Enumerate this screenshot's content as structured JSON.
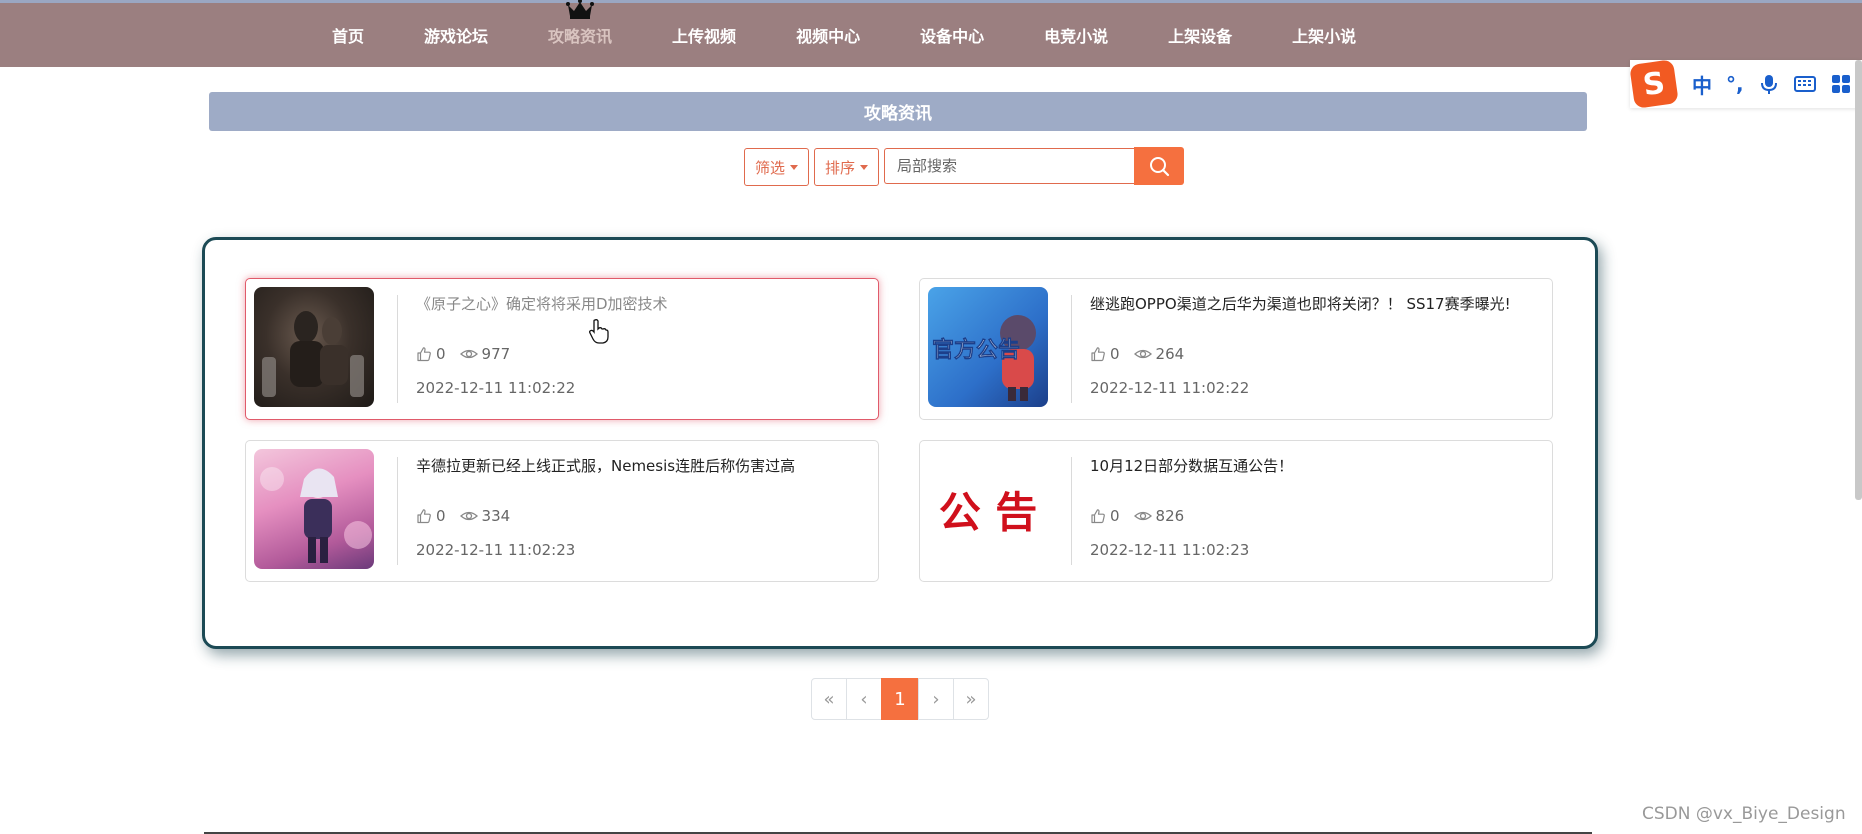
{
  "nav": {
    "items": [
      {
        "label": "首页"
      },
      {
        "label": "游戏论坛"
      },
      {
        "label": "攻略资讯"
      },
      {
        "label": "上传视频"
      },
      {
        "label": "视频中心"
      },
      {
        "label": "设备中心"
      },
      {
        "label": "电竞小说"
      },
      {
        "label": "上架设备"
      },
      {
        "label": "上架小说"
      }
    ],
    "active_index": 2,
    "active_icon": "crown-icon"
  },
  "ime": {
    "logo": "S",
    "mode": "中",
    "punct": "°,",
    "icons": [
      "microphone-icon",
      "keyboard-icon",
      "grid-icon"
    ]
  },
  "page": {
    "title": "攻略资讯"
  },
  "toolbar": {
    "filter_label": "筛选",
    "sort_label": "排序",
    "search_placeholder": "局部搜索",
    "search_icon": "search-icon"
  },
  "articles": [
    {
      "title": "《原子之心》确定将将采用D加密技术",
      "likes": "0",
      "views": "977",
      "date": "2022-12-11 11:02:22"
    },
    {
      "title": "继逃跑OPPO渠道之后华为渠道也即将关闭？！ SS17赛季曝光!",
      "likes": "0",
      "views": "264",
      "date": "2022-12-11 11:02:22",
      "thumb_text": "官方公告"
    },
    {
      "title": "辛德拉更新已经上线正式服，Nemesis连胜后称伤害过高",
      "likes": "0",
      "views": "334",
      "date": "2022-12-11 11:02:23"
    },
    {
      "title": "10月12日部分数据互通公告！",
      "likes": "0",
      "views": "826",
      "date": "2022-12-11 11:02:23",
      "thumb_text": "公 告"
    }
  ],
  "pagination": {
    "first": "«",
    "prev": "‹",
    "current": "1",
    "next": "›",
    "last": "»"
  },
  "colors": {
    "navbar": "#9b7f80",
    "title_bar": "#9eabc6",
    "accent": "#f5703f",
    "panel_border": "#1c4a55"
  },
  "watermark": "CSDN @vx_Biye_Design"
}
